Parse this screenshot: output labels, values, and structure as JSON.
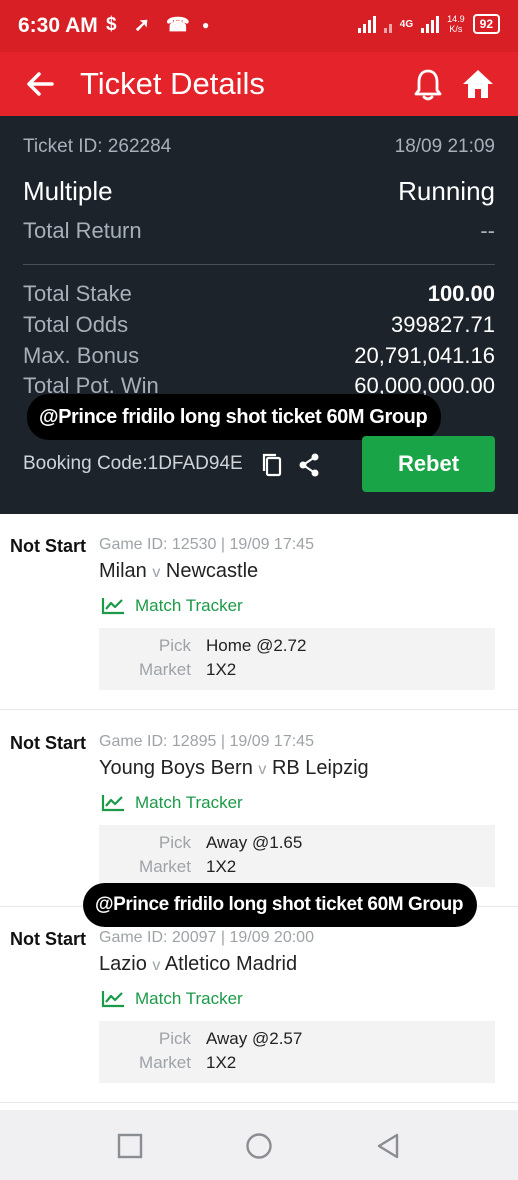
{
  "status_bar": {
    "time": "6:30 AM",
    "net_type": "4G",
    "net_speed": "14.9",
    "net_unit": "K/s",
    "battery": "92"
  },
  "header": {
    "title": "Ticket Details"
  },
  "ticket": {
    "id_label": "Ticket ID: 262284",
    "datetime": "18/09 21:09",
    "type": "Multiple",
    "status": "Running",
    "total_return_label": "Total Return",
    "total_return_value": "--",
    "total_stake_label": "Total Stake",
    "total_stake_value": "100.00",
    "total_odds_label": "Total Odds",
    "total_odds_value": "399827.71",
    "max_bonus_label": "Max. Bonus",
    "max_bonus_value": "20,791,041.16",
    "total_pot_win_label": "Total Pot. Win",
    "total_pot_win_value": "60,000,000.00",
    "booking_code_label": "Booking Code:1DFAD94E",
    "rebet_label": "Rebet"
  },
  "watermark_text": "@Prince fridilo long shot ticket 60M Group",
  "bets": [
    {
      "status": "Not Start",
      "meta": "Game ID: 12530 | 19/09 17:45",
      "home": "Milan",
      "vs": "v",
      "away": "Newcastle",
      "tracker": "Match Tracker",
      "pick_label": "Pick",
      "pick": "Home @2.72",
      "market_label": "Market",
      "market": "1X2"
    },
    {
      "status": "Not Start",
      "meta": "Game ID: 12895 | 19/09 17:45",
      "home": "Young Boys Bern",
      "vs": "v",
      "away": "RB Leipzig",
      "tracker": "Match Tracker",
      "pick_label": "Pick",
      "pick": "Away @1.65",
      "market_label": "Market",
      "market": "1X2"
    },
    {
      "status": "Not Start",
      "meta": "Game ID: 20097 | 19/09 20:00",
      "home": "Lazio",
      "vs": "v",
      "away": "Atletico Madrid",
      "tracker": "Match Tracker",
      "pick_label": "Pick",
      "pick": "Away @2.57",
      "market_label": "Market",
      "market": "1X2"
    }
  ],
  "colors": {
    "brand_red": "#e4232a",
    "status_red": "#d81f26",
    "panel_dark": "#1c232b",
    "rebet_green": "#19a448",
    "tracker_green": "#1b9a48"
  }
}
